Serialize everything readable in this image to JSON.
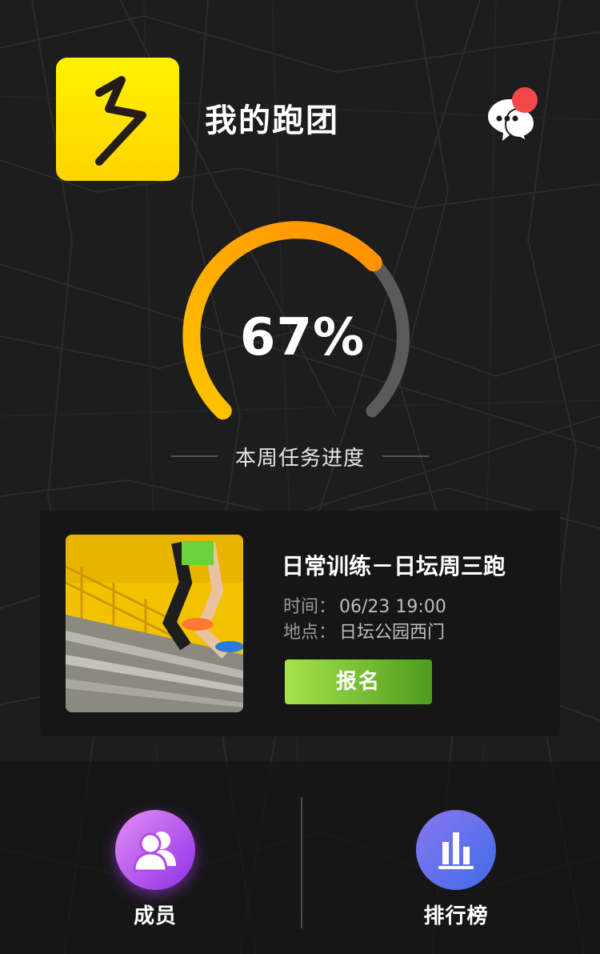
{
  "header": {
    "title": "我的跑团",
    "logo_icon": "running-club-logo-icon",
    "message_icon": "chat-bubbles-icon",
    "has_unread": true
  },
  "progress": {
    "value": 0.67,
    "percent_label": "67%",
    "caption": "本周任务进度"
  },
  "event": {
    "title": "日常训练－日坛周三跑",
    "time_label": "时间：",
    "time_value": "06/23 19:00",
    "place_label": "地点：",
    "place_value": "日坛公园西门",
    "signup_label": "报名"
  },
  "nav": {
    "members_label": "成员",
    "members_icon": "members-icon",
    "ranking_label": "排行榜",
    "ranking_icon": "bar-chart-icon"
  },
  "colors": {
    "accent_yellow": "#ffd400",
    "progress_start": "#ffc400",
    "progress_end": "#ff9000",
    "track": "#5a5a5a",
    "badge_red": "#f44848",
    "signup_green": "#7cc43a"
  }
}
